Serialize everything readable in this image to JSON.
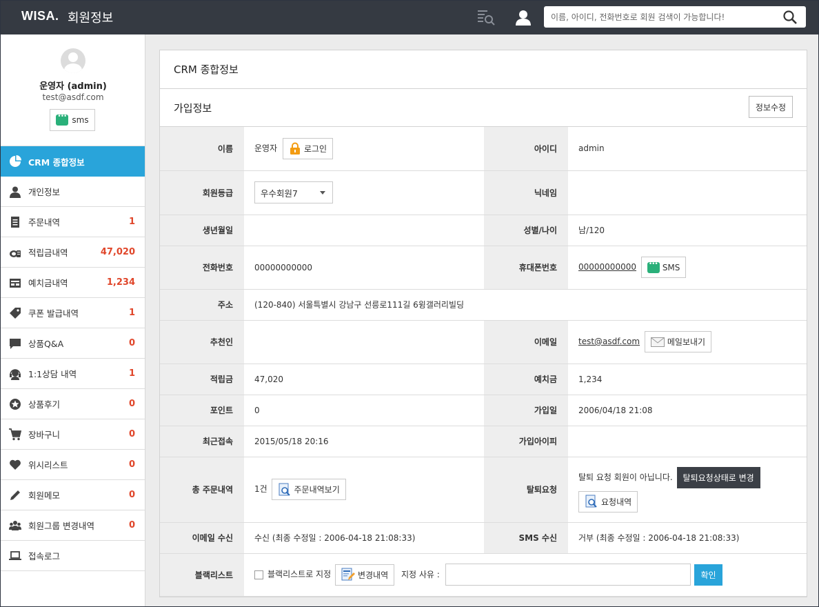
{
  "header": {
    "brand": "WISA.",
    "title": "회원정보",
    "search_placeholder": "이름, 아이디, 전화번호로 회원 검색이 가능합니다!",
    "colors": {
      "bar": "#353a42",
      "accent": "#29a4da",
      "alert": "#e0462a"
    }
  },
  "profile": {
    "name": "운영자 (admin)",
    "email": "test@asdf.com",
    "sms_label": "sms"
  },
  "menu": [
    {
      "label": "CRM 종합정보",
      "count": "",
      "icon": "pie-chart-icon",
      "active": true
    },
    {
      "label": "개인정보",
      "count": "",
      "icon": "user-icon"
    },
    {
      "label": "주문내역",
      "count": "1",
      "icon": "document-icon"
    },
    {
      "label": "적립금내역",
      "count": "47,020",
      "icon": "coins-icon"
    },
    {
      "label": "예치금내역",
      "count": "1,234",
      "icon": "wallet-icon"
    },
    {
      "label": "쿠폰 발급내역",
      "count": "1",
      "icon": "tag-icon"
    },
    {
      "label": "상품Q&A",
      "count": "0",
      "icon": "speech-bubble-icon"
    },
    {
      "label": "1:1상담 내역",
      "count": "1",
      "icon": "headset-icon"
    },
    {
      "label": "상품후기",
      "count": "0",
      "icon": "star-icon"
    },
    {
      "label": "장바구니",
      "count": "0",
      "icon": "cart-icon"
    },
    {
      "label": "위시리스트",
      "count": "0",
      "icon": "heart-icon"
    },
    {
      "label": "회원메모",
      "count": "0",
      "icon": "pencil-icon"
    },
    {
      "label": "회원그룹 변경내역",
      "count": "0",
      "icon": "group-icon"
    },
    {
      "label": "접속로그",
      "count": "",
      "icon": "laptop-icon"
    }
  ],
  "main": {
    "panel_title": "CRM 종합정보",
    "section_title": "가입정보",
    "edit_button": "정보수정",
    "fields": {
      "name_label": "이름",
      "name_value": "운영자",
      "login_button": "로그인",
      "id_label": "아이디",
      "id_value": "admin",
      "grade_label": "회원등급",
      "grade_value": "우수회원7",
      "nickname_label": "닉네임",
      "nickname_value": "",
      "birth_label": "생년월일",
      "birth_value": "",
      "gender_age_label": "성별/나이",
      "gender_age_value": "남/120",
      "phone_label": "전화번호",
      "phone_value": "00000000000",
      "mobile_label": "휴대폰번호",
      "mobile_value": "00000000000",
      "sms_button": "SMS",
      "address_label": "주소",
      "address_value": "(120-840) 서울특별시 강남구 선릉로111길 6윙갤러리빌딩",
      "referrer_label": "추천인",
      "referrer_value": "",
      "email_label": "이메일",
      "email_value": "test@asdf.com",
      "email_button": "메일보내기",
      "points_label": "적립금",
      "points_value": "47,020",
      "deposit_label": "예치금",
      "deposit_value": "1,234",
      "point2_label": "포인트",
      "point2_value": "0",
      "join_date_label": "가입일",
      "join_date_value": "2006/04/18 21:08",
      "last_login_label": "최근접속",
      "last_login_value": "2015/05/18 20:16",
      "join_ip_label": "가입아이피",
      "join_ip_value": "",
      "orders_label": "총 주문내역",
      "orders_value": "1건",
      "orders_button": "주문내역보기",
      "withdraw_label": "탈퇴요청",
      "withdraw_value": "탈퇴 요청 회원이 아닙니다.",
      "withdraw_change_button": "탈퇴요청상태로 변경",
      "withdraw_history_button": "요청내역",
      "email_recv_label": "이메일 수신",
      "email_recv_value": "수신 (최종 수정일 : 2006-04-18 21:08:33)",
      "sms_recv_label": "SMS 수신",
      "sms_recv_value": "거부 (최종 수정일 : 2006-04-18 21:08:33)",
      "blacklist_label": "블랙리스트",
      "blacklist_checkbox": "블랙리스트로 지정",
      "blacklist_history_button": "변경내역",
      "reason_label": "지정 사유 :",
      "confirm_button": "확인"
    }
  }
}
